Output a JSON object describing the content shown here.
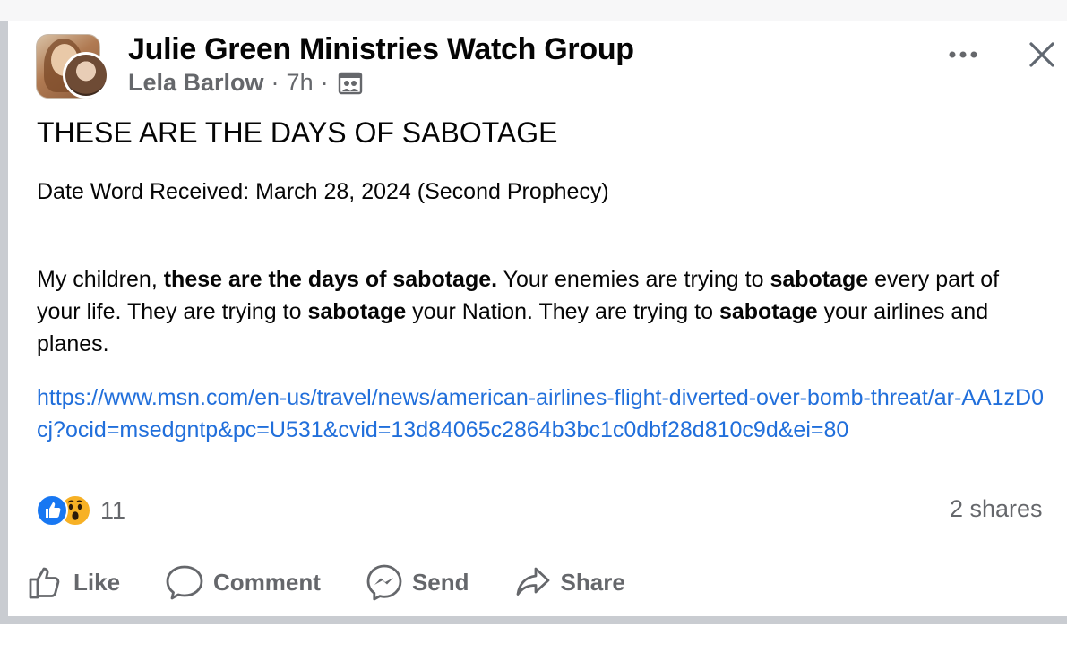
{
  "post": {
    "group_name": "Julie Green Ministries Watch Group",
    "author": "Lela Barlow",
    "time": "7h",
    "separator": "·",
    "audience_icon": "group-members-icon",
    "more_icon": "more-options-icon",
    "close_icon": "close-icon",
    "headline": "THESE ARE THE DAYS OF SABOTAGE",
    "date_line": "Date Word Received: March 28, 2024 (Second Prophecy)",
    "body": {
      "p1": "My children, ",
      "b1": "these are the days of sabotage.",
      "p2": " Your enemies are trying to ",
      "b2": "sabotage",
      "p3": " every part of your life. They are trying to ",
      "b3": "sabotage",
      "p4": " your Nation. They are trying to ",
      "b4": "sabotage",
      "p5": " your airlines and planes."
    },
    "link": "https://www.msn.com/en-us/travel/news/american-airlines-flight-diverted-over-bomb-threat/ar-AA1zD0cj?ocid=msedgntp&pc=U531&cvid=13d84065c2864b3bc1c0dbf28d810c9d&ei=80",
    "reactions": {
      "icons": [
        "like-reaction-icon",
        "wow-reaction-icon"
      ],
      "count": "11"
    },
    "shares": "2 shares"
  },
  "actions": {
    "like": "Like",
    "comment": "Comment",
    "send": "Send",
    "share": "Share"
  },
  "colors": {
    "link": "#216fdb",
    "secondary_text": "#65676b",
    "like_blue": "#1877f2",
    "wow_yellow": "#f7b125",
    "separator_gray": "#c9ccd1"
  }
}
